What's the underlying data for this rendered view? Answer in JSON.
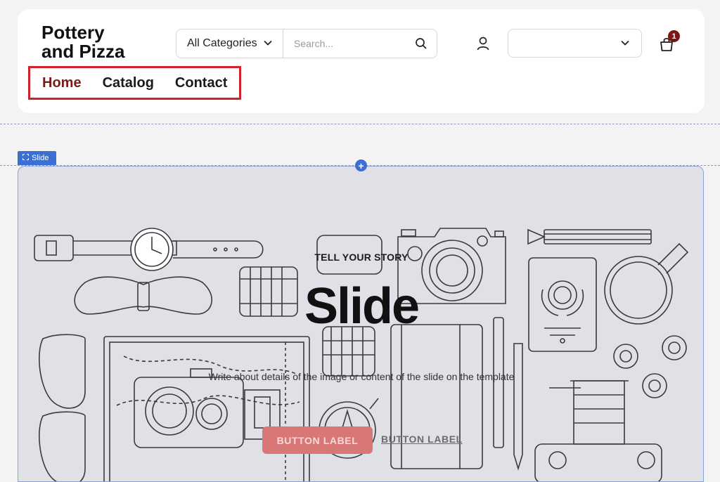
{
  "header": {
    "logo_line1": "Pottery",
    "logo_line2": "and Pizza",
    "category_select": "All Categories",
    "search_placeholder": "Search...",
    "cart_count": "1",
    "icons": [
      "chevron-down-icon",
      "search-icon",
      "user-icon",
      "cart-icon"
    ]
  },
  "nav": {
    "items": [
      {
        "label": "Home",
        "active": true
      },
      {
        "label": "Catalog",
        "active": false
      },
      {
        "label": "Contact",
        "active": false
      }
    ]
  },
  "editor": {
    "slide_tag": "Slide",
    "add_symbol": "+"
  },
  "slide": {
    "eyebrow": "TELL YOUR STORY",
    "headline": "Slide",
    "description": "Write about details of the image or content of the slide on the template",
    "primary_button": "BUTTON LABEL",
    "secondary_button": "BUTTON LABEL"
  },
  "colors": {
    "brand_dark_red": "#7a1a1a",
    "highlight_red": "#d4202c",
    "editor_blue": "#3b6fd4",
    "slide_bg": "#e0e1e6",
    "button_primary": "#d97777"
  }
}
